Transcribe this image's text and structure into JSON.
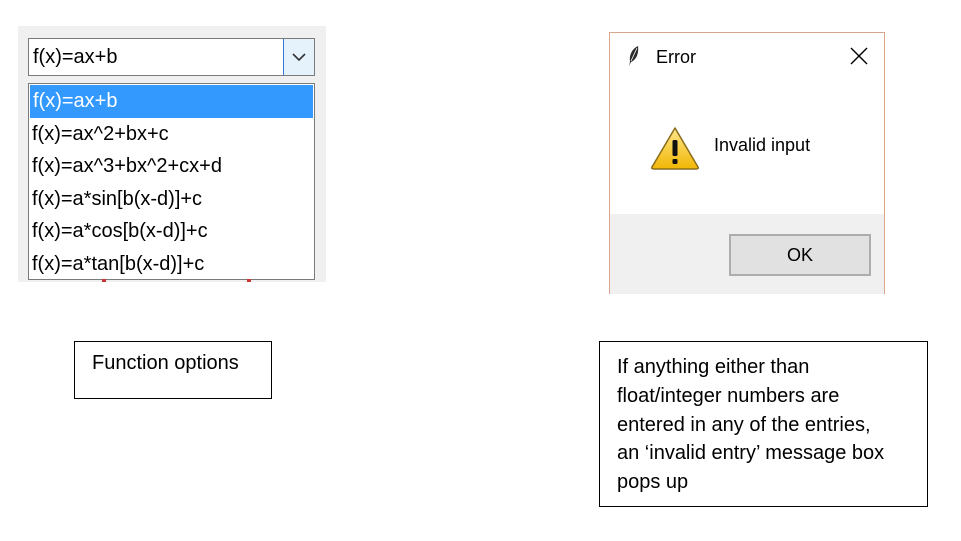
{
  "combobox": {
    "selected_value": "f(x)=ax+b",
    "options": [
      "f(x)=ax+b",
      "f(x)=ax^2+bx+c",
      "f(x)=ax^3+bx^2+cx+d",
      "f(x)=a*sin[b(x-d)]+c",
      "f(x)=a*cos[b(x-d)]+c",
      "f(x)=a*tan[b(x-d)]+c"
    ],
    "highlighted_index": 0,
    "arrow_icon": "chevron-down-icon"
  },
  "dialog": {
    "title": "Error",
    "title_icon": "feather-icon",
    "message_icon": "warning-icon",
    "message": "Invalid input",
    "ok_label": "OK",
    "close_icon": "close-icon"
  },
  "captions": {
    "left": "Function options",
    "right_lines": [
      "If anything either than",
      "float/integer numbers are",
      "entered in any of the entries,",
      "an ‘invalid entry’ message box",
      "pops up"
    ]
  },
  "colors": {
    "selection": "#3399ff",
    "dialog_border": "#d9a58c",
    "warning": "#f5c518"
  }
}
